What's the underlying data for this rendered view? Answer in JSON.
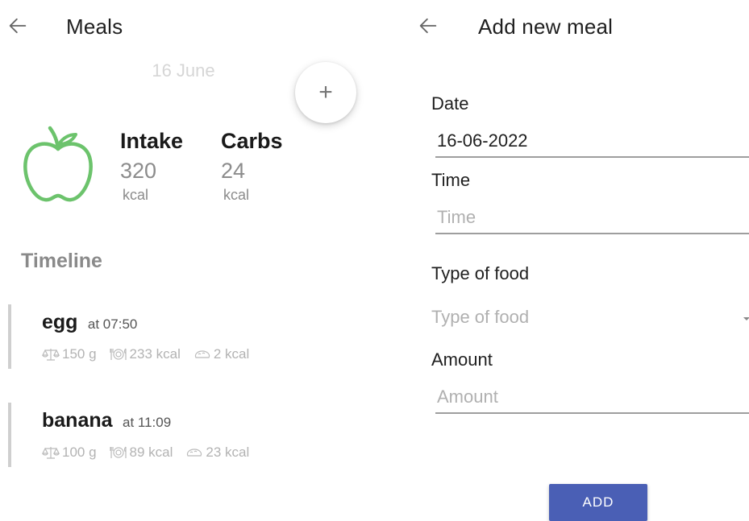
{
  "colors": {
    "accent": "#4a5fb5",
    "apple_green": "#6cc36c",
    "timeline_bar": "#cfcfcf",
    "muted_text": "#b3b3b3"
  },
  "meals_screen": {
    "title": "Meals",
    "date": "16 June",
    "fab_label": "+",
    "stats": {
      "intake": {
        "label": "Intake",
        "value": "320",
        "unit": "kcal"
      },
      "carbs": {
        "label": "Carbs",
        "value": "24",
        "unit": "kcal"
      }
    },
    "timeline_title": "Timeline",
    "entries": [
      {
        "name": "egg",
        "time": "at 07:50",
        "weight": "150 g",
        "calories": "233 kcal",
        "carbs": "2 kcal"
      },
      {
        "name": "banana",
        "time": "at 11:09",
        "weight": "100 g",
        "calories": "89 kcal",
        "carbs": "23 kcal"
      }
    ],
    "icons": {
      "back": "arrow-left-icon",
      "weight": "scale-icon",
      "calories": "plate-cutlery-icon",
      "carbs": "bread-icon",
      "logo": "apple-icon"
    }
  },
  "add_meal_screen": {
    "title": "Add new meal",
    "date": {
      "label": "Date",
      "value": "16-06-2022"
    },
    "time": {
      "label": "Time",
      "value": "",
      "placeholder": "Time"
    },
    "food_type": {
      "label": "Type of food",
      "selected": "Type of food"
    },
    "amount": {
      "label": "Amount",
      "value": "",
      "placeholder": "Amount"
    },
    "add_label": "ADD"
  }
}
